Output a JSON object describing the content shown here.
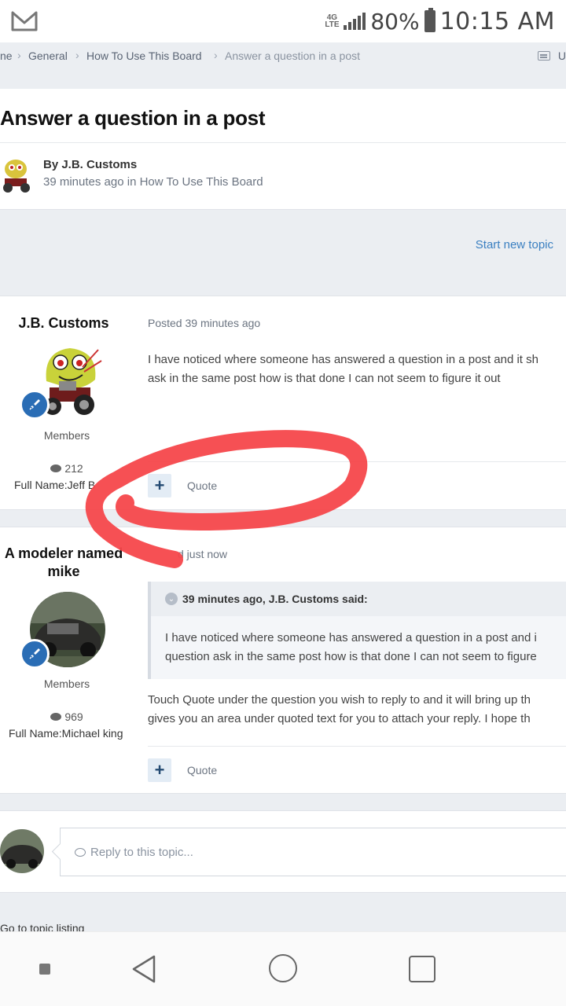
{
  "status_bar": {
    "network": "4G LTE",
    "battery_percent": "80%",
    "time": "10:15 AM",
    "icons": [
      "gmail-icon",
      "signal-icon",
      "battery-icon"
    ]
  },
  "breadcrumb": {
    "items": [
      "ne",
      "General",
      "How To Use This Board",
      "Answer a question in a post"
    ],
    "unread_label": "U"
  },
  "topic": {
    "title": "Answer a question in a post",
    "byline": "By J.B. Customs",
    "meta": "39 minutes ago in How To Use This Board"
  },
  "start_new_topic": "Start new topic",
  "posts": [
    {
      "author": "J.B. Customs",
      "group": "Members",
      "post_count": "212",
      "full_name": "Full Name:Jeff B",
      "posted": "Posted 39 minutes ago",
      "body_lines": [
        "I have noticed where someone has answered a question in a post and it sh",
        "ask in the same post how is that done I can not seem to figure it out"
      ],
      "quote_label": "Quote"
    },
    {
      "author_line1": "A modeler named",
      "author_line2": "mike",
      "group": "Members",
      "post_count": "969",
      "full_name": "Full Name:Michael king",
      "posted": "d just now",
      "quote_header": "39 minutes ago, J.B. Customs said:",
      "quote_lines": [
        "I have noticed where someone has answered a question in a post and i",
        "question ask in the same post how is that done I can not seem to figure"
      ],
      "body_lines": [
        "Touch Quote under the question you wish to reply to and it will bring up th",
        "gives you an area under quoted text for you to attach your reply. I hope th"
      ],
      "quote_label": "Quote"
    }
  ],
  "reply": {
    "placeholder": "Reply to this topic..."
  },
  "go_to_listing": "Go to topic listing",
  "colors": {
    "link": "#3a7fc1",
    "badge": "#2a6db5",
    "annotation": "#f5474b"
  }
}
